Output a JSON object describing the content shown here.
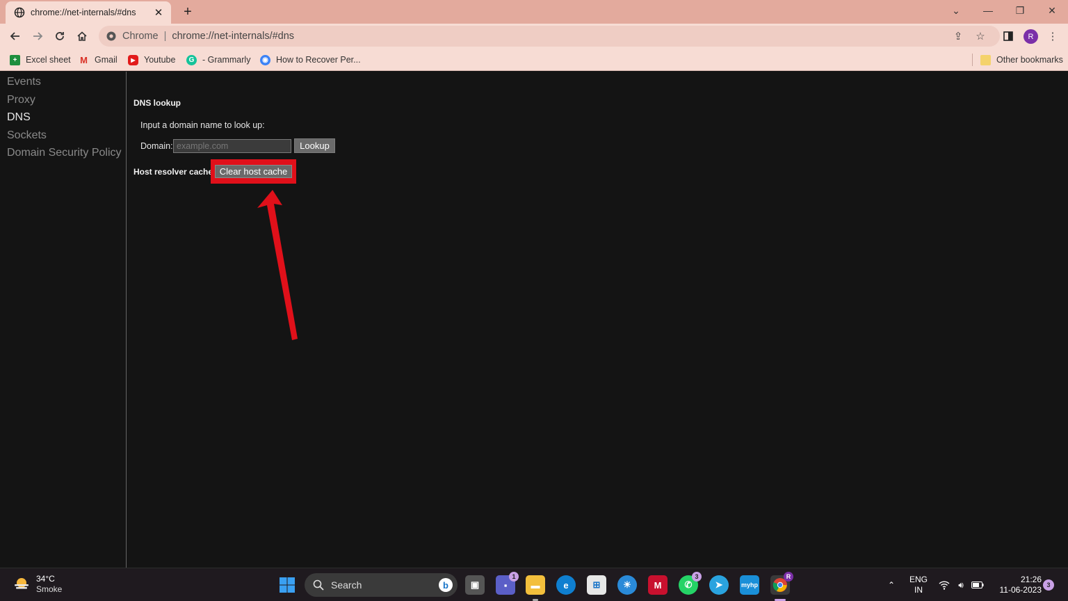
{
  "browser": {
    "tab_title": "chrome://net-internals/#dns",
    "omnibox_site": "Chrome",
    "omnibox_separator": "|",
    "omnibox_url": "chrome://net-internals/#dns",
    "profile_initial": "R"
  },
  "bookmarks": [
    {
      "label": "Excel sheet",
      "icon": "excel-icon"
    },
    {
      "label": "Gmail",
      "icon": "gmail-icon"
    },
    {
      "label": "Youtube",
      "icon": "youtube-icon"
    },
    {
      "label": "- Grammarly",
      "icon": "grammarly-icon"
    },
    {
      "label": "How to Recover Per...",
      "icon": "site-icon"
    }
  ],
  "other_bookmarks": "Other bookmarks",
  "sidebar": {
    "items": [
      "Events",
      "Proxy",
      "DNS",
      "Sockets",
      "Domain Security Policy"
    ],
    "active": "DNS"
  },
  "dns": {
    "heading": "DNS lookup",
    "prompt": "Input a domain name to look up:",
    "domain_label": "Domain:",
    "domain_placeholder": "example.com",
    "domain_value": "",
    "lookup_button": "Lookup",
    "cache_label": "Host resolver cache",
    "clear_button": "Clear host cache"
  },
  "annotation": {
    "color": "#e0101a"
  },
  "taskbar": {
    "weather_temp": "34°C",
    "weather_cond": "Smoke",
    "search_label": "Search",
    "lang_line1": "ENG",
    "lang_line2": "IN",
    "time": "21:26",
    "date": "11-06-2023",
    "notification_count": "3",
    "teams_badge": "1",
    "whatsapp_badge": "3",
    "chrome_badge": "R"
  }
}
